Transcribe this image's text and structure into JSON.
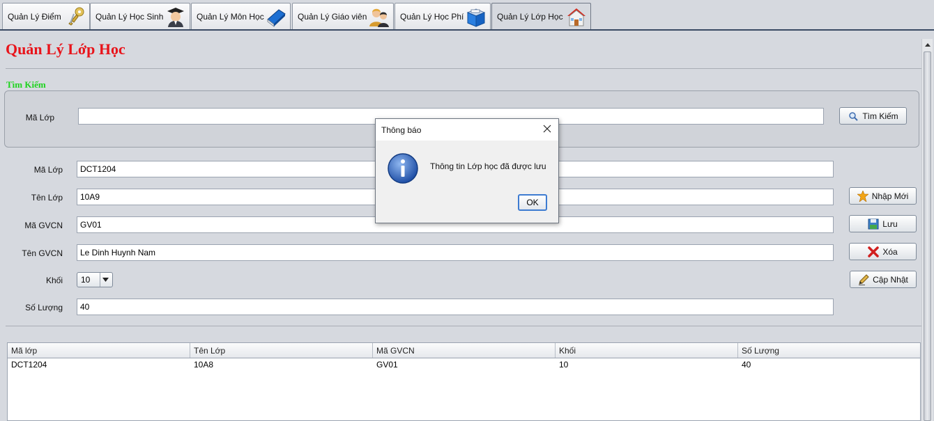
{
  "tabs": [
    {
      "label": "Quản Lý Điểm",
      "icon": "keys-icon"
    },
    {
      "label": "Quản Lý Học Sinh",
      "icon": "student-icon"
    },
    {
      "label": "Quản Lý Môn Học",
      "icon": "book-icon"
    },
    {
      "label": "Quản Lý Giáo viên",
      "icon": "teachers-icon"
    },
    {
      "label": "Quản Lý Học Phí",
      "icon": "fee-box-icon"
    },
    {
      "label": "Quản Lý Lớp Học",
      "icon": "house-icon"
    }
  ],
  "active_tab": "Quản Lý Lớp Học",
  "page": {
    "title": "Quản Lý Lớp Học",
    "search_section_label": "Tìm Kiếm"
  },
  "search": {
    "label": "Mã Lớp",
    "value": "",
    "button": "Tìm Kiếm"
  },
  "form": {
    "ma_lop_label": "Mã Lớp",
    "ma_lop_value": "DCT1204",
    "ten_lop_label": "Tên Lớp",
    "ten_lop_value": "10A9",
    "ma_gvcn_label": "Mã GVCN",
    "ma_gvcn_value": "GV01",
    "ten_gvcn_label": "Tên GVCN",
    "ten_gvcn_value": "Le Dinh Huynh Nam",
    "khoi_label": "Khối",
    "khoi_value": "10",
    "so_luong_label": "Số Lượng",
    "so_luong_value": "40"
  },
  "actions": {
    "new": "Nhập Mới",
    "save": "Lưu",
    "delete": "Xóa",
    "update": "Cập Nhật"
  },
  "table": {
    "columns": [
      "Mã lớp",
      "Tên Lớp",
      "Mã GVCN",
      "Khối",
      "Số Lượng"
    ],
    "rows": [
      [
        "DCT1204",
        "10A8",
        "GV01",
        "10",
        "40"
      ]
    ]
  },
  "dialog": {
    "title": "Thông báo",
    "message": "Thông tin Lớp học đã được lưu",
    "ok": "OK"
  },
  "colors": {
    "title_red": "#e8141b",
    "section_green": "#1dd31d",
    "background": "#d6d9df"
  }
}
